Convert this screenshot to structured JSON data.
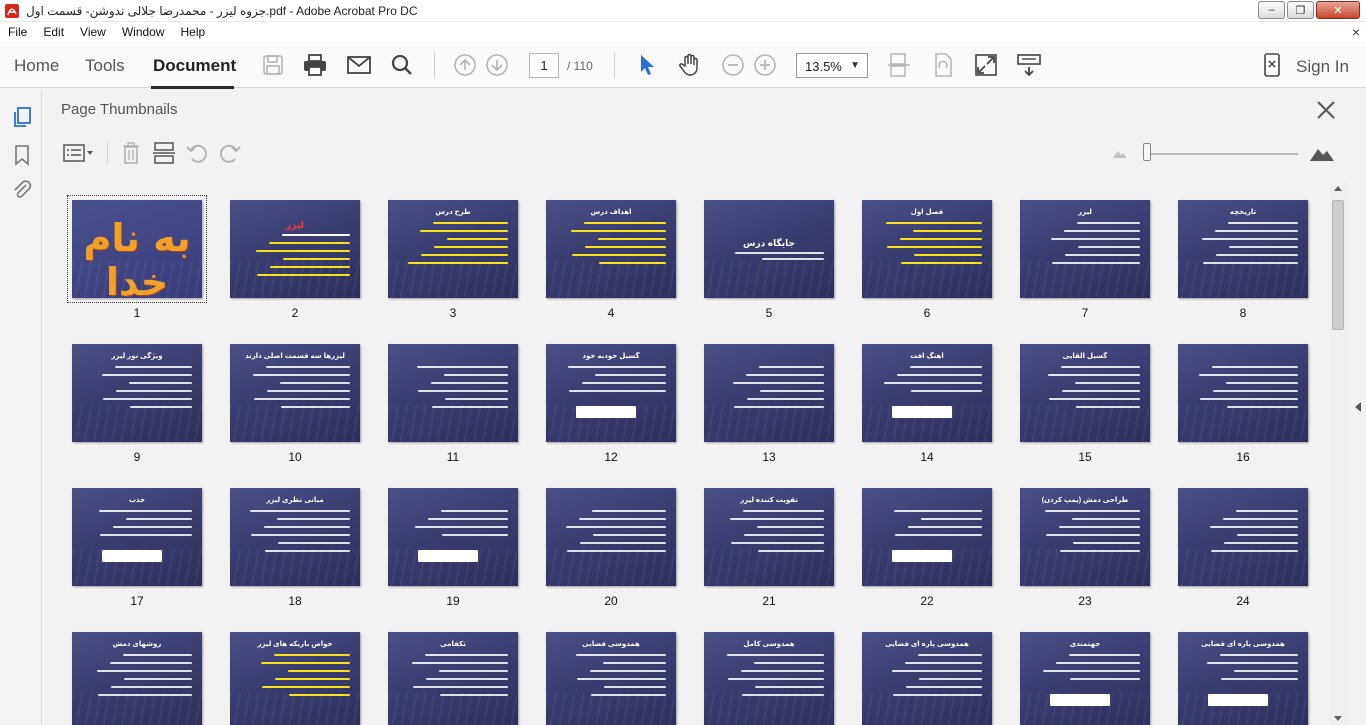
{
  "window": {
    "title": "جزوه لیزر - محمدرضا جلالی ندوشن- قسمت اول.pdf - Adobe Acrobat Pro DC",
    "minimize": "–",
    "maximize": "❐",
    "close": "✕"
  },
  "menu": {
    "items": [
      "File",
      "Edit",
      "View",
      "Window",
      "Help"
    ],
    "close_glyph": "×"
  },
  "toolbar": {
    "tabs": [
      "Home",
      "Tools",
      "Document"
    ],
    "active_tab": "Document",
    "current_page": "1",
    "total_pages": "/ 110",
    "zoom": "13.5%",
    "sign_in": "Sign In"
  },
  "panel": {
    "title": "Page Thumbnails"
  },
  "thumbnails": [
    {
      "n": "1",
      "title": "به نام خدا",
      "kind": "title"
    },
    {
      "n": "2",
      "title": "لیزر",
      "kind": "red"
    },
    {
      "n": "3",
      "title": "طرح درس",
      "kind": "list"
    },
    {
      "n": "4",
      "title": "اهداف درس",
      "kind": "list"
    },
    {
      "n": "5",
      "title": "جایگاه درس",
      "kind": "center"
    },
    {
      "n": "6",
      "title": "فصل اول",
      "kind": "list"
    },
    {
      "n": "7",
      "title": "لیزر",
      "kind": "text"
    },
    {
      "n": "8",
      "title": "تاریخچه",
      "kind": "text"
    },
    {
      "n": "9",
      "title": "ویژگی نور لیزر",
      "kind": "text"
    },
    {
      "n": "10",
      "title": "لیزرها سه قسمت اصلی دارند",
      "kind": "text"
    },
    {
      "n": "11",
      "title": "",
      "kind": "text"
    },
    {
      "n": "12",
      "title": "گسیل خودبه خود",
      "kind": "formula"
    },
    {
      "n": "13",
      "title": "",
      "kind": "text"
    },
    {
      "n": "14",
      "title": "آهنگ افت",
      "kind": "formula"
    },
    {
      "n": "15",
      "title": "گسیل القایی",
      "kind": "text"
    },
    {
      "n": "16",
      "title": "",
      "kind": "text"
    },
    {
      "n": "17",
      "title": "جذب",
      "kind": "formula"
    },
    {
      "n": "18",
      "title": "مبانی نظری لیزر",
      "kind": "text"
    },
    {
      "n": "19",
      "title": "",
      "kind": "formula"
    },
    {
      "n": "20",
      "title": "",
      "kind": "text"
    },
    {
      "n": "21",
      "title": "تقویت کننده لیزر",
      "kind": "text"
    },
    {
      "n": "22",
      "title": "",
      "kind": "formula"
    },
    {
      "n": "23",
      "title": "طراحی دمش (پمپ کردن)",
      "kind": "text"
    },
    {
      "n": "24",
      "title": "",
      "kind": "text"
    },
    {
      "n": "",
      "title": "روشهای دمش",
      "kind": "text"
    },
    {
      "n": "",
      "title": "خواص باریکه های لیزر",
      "kind": "list"
    },
    {
      "n": "",
      "title": "تکفامی",
      "kind": "text"
    },
    {
      "n": "",
      "title": "همدوسی فضایی",
      "kind": "text"
    },
    {
      "n": "",
      "title": "همدوسی کامل",
      "kind": "text"
    },
    {
      "n": "",
      "title": "همدوسی پاره ای فضایی",
      "kind": "text"
    },
    {
      "n": "",
      "title": "جهتمندی",
      "kind": "formula"
    },
    {
      "n": "",
      "title": "همدوسی پاره ای فضایی",
      "kind": "formula"
    }
  ],
  "colors": {
    "slide_text": "#ffffff",
    "slide_yellow": "#f5e21a",
    "title_orange": "#f0a12a",
    "accent_blue": "#2a6fd6"
  }
}
